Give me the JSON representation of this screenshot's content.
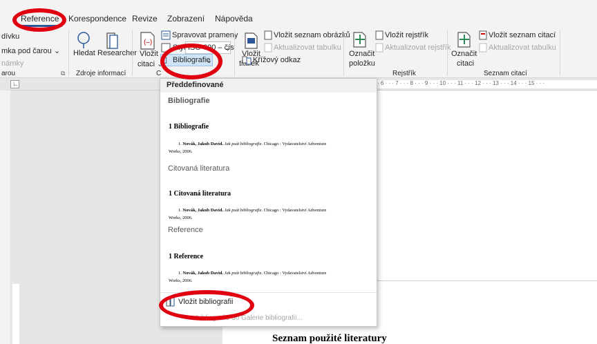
{
  "tabs": [
    {
      "label": "Reference",
      "active": true
    },
    {
      "label": "Korespondence"
    },
    {
      "label": "Revize"
    },
    {
      "label": "Zobrazení"
    },
    {
      "label": "Nápověda"
    }
  ],
  "ribbon": {
    "left_partial": {
      "line1": "dívku",
      "line2": "mka pod čarou",
      "line3": "námky",
      "group": "arou"
    },
    "research": {
      "hledat": "Hledat",
      "researcher": "Researcher",
      "group": "Zdroje informací"
    },
    "citations": {
      "vlozit": "Vložit",
      "citaci": "citaci",
      "spravovat": "Spravovat prameny",
      "styl": "Styl:",
      "styl_value": "ISO 690 – čís",
      "bibliografie": "Bibliografie",
      "group": "C"
    },
    "captions": {
      "vlozit": "Vložit",
      "titulek": "titulek",
      "seznam_obrazku": "Vložit seznam obrázků",
      "aktualizovat": "Aktualizovat tabulku",
      "krizovy": "Křížový odkaz"
    },
    "index": {
      "oznacit": "Označit",
      "polozku": "položku",
      "vlozit_rejstrik": "Vložit rejstřík",
      "aktualizovat_rejstrik": "Aktualizovat rejstřík",
      "group": "Rejstřík"
    },
    "toa": {
      "oznacit": "Označit",
      "citaci": "citaci",
      "vlozit_seznam": "Vložit seznam citací",
      "aktualizovat": "Aktualizovat tabulku",
      "group": "Seznam citací"
    }
  },
  "ruler": {
    "marks": "· 6 · · · 7 · · · 8 · · · 9 · · · 10 · · · 11 · · · 12 · · · 13 · · · 14 · · · 15 · · ·"
  },
  "dropdown": {
    "header": "Předdefinované",
    "items": [
      {
        "name": "Bibliografie",
        "heading": "1   Bibliografie",
        "entry_num": "1.",
        "entry_author": "Novák, Jakub David.",
        "entry_title": "Jak psát bibliografie.",
        "entry_rest": "Chicago : Vydavatelství Adventure",
        "entry_line2": "Works, 2006."
      },
      {
        "name": "Citovaná literatura",
        "heading": "1   Citovaná literatura",
        "entry_num": "1.",
        "entry_author": "Novák, Jakub David.",
        "entry_title": "Jak psát bibliografie.",
        "entry_rest": "Chicago : Vydavatelství Adventure",
        "entry_line2": "Works, 2006."
      },
      {
        "name": "Reference",
        "heading": "1   Reference",
        "entry_num": "1.",
        "entry_author": "Novák, Jakub David.",
        "entry_title": "Jak psát bibliografie.",
        "entry_rest": "Chicago : Vydavatelství Adventure",
        "entry_line2": "Works, 2006."
      }
    ],
    "insert_label": "Vložit bibliografii",
    "save_label": "bibliografie do Galerie bibliografií..."
  },
  "document": {
    "heading": "Seznam použité literatury"
  },
  "colors": {
    "highlight_ring": "#e0000f",
    "accent": "#2b579a"
  }
}
